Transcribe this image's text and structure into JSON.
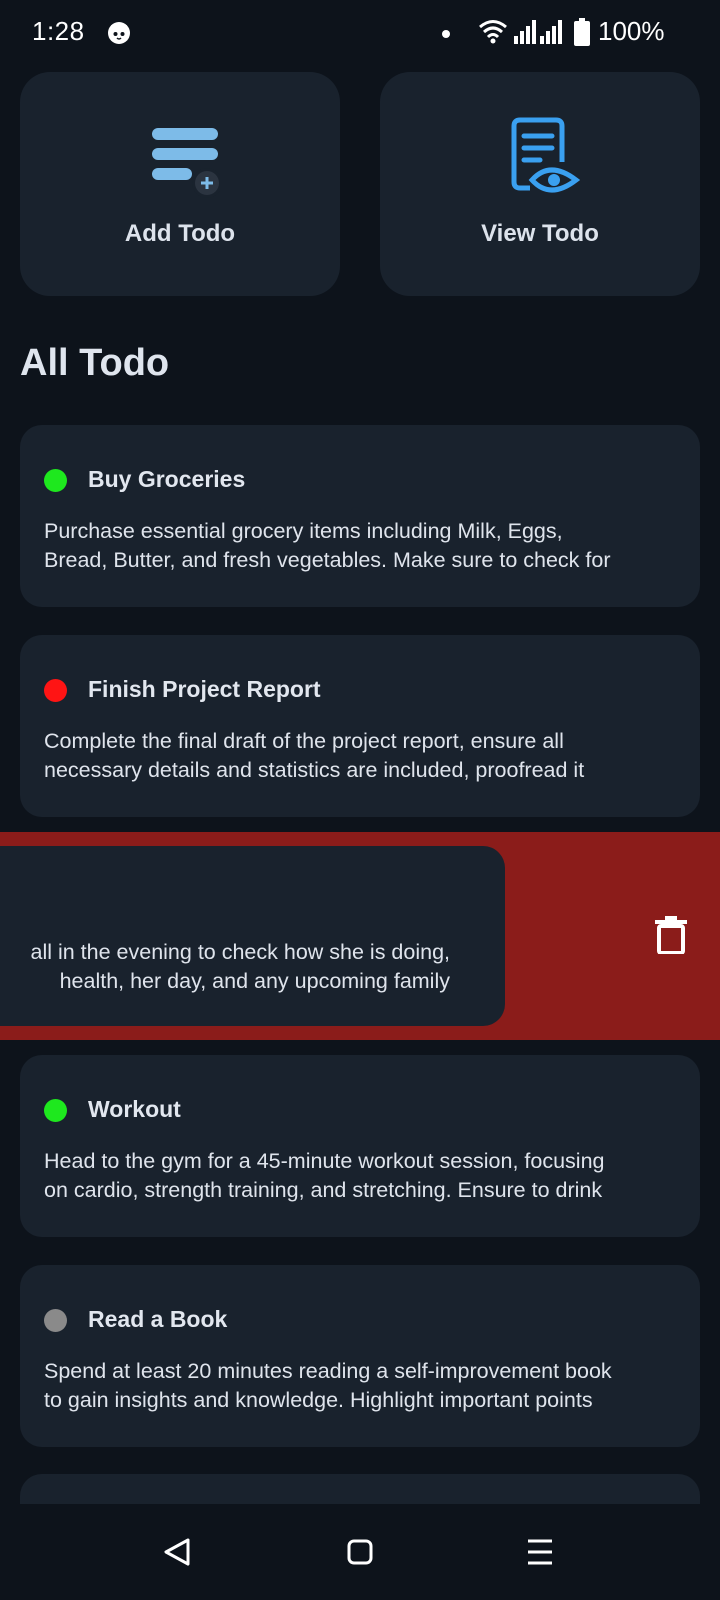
{
  "status_bar": {
    "time": "1:28",
    "battery": "100%"
  },
  "actions": {
    "add_label": "Add Todo",
    "view_label": "View Todo"
  },
  "section_title": "All Todo",
  "todos": [
    {
      "title": "Buy Groceries",
      "description": "Purchase essential grocery items including Milk, Eggs, Bread, Butter, and fresh vegetables. Make sure to check for",
      "line1": "Purchase essential grocery items including Milk, Eggs,",
      "line2": "Bread, Butter, and fresh vegetables. Make sure to check for",
      "status_color": "#1ee81e"
    },
    {
      "title": "Finish Project Report",
      "line1": "Complete the final draft of the project report, ensure all",
      "line2": "necessary details and statistics are included, proofread it",
      "status_color": "#ff1414"
    },
    {
      "line1": "all in the evening to check how she is doing,",
      "line2": "health, her day, and any upcoming family",
      "swiped": true
    },
    {
      "title": "Workout",
      "line1": "Head to the gym for a 45-minute workout session, focusing",
      "line2": "on cardio, strength training, and stretching. Ensure to drink",
      "status_color": "#1ee81e"
    },
    {
      "title": "Read a Book",
      "line1": "Spend at least 20 minutes reading a self-improvement book",
      "line2": "to gain insights and knowledge. Highlight important points",
      "status_color": "#8a8a8a"
    }
  ],
  "icons": {
    "add": "add-todo-icon",
    "view": "view-todo-icon",
    "delete": "trash-icon"
  },
  "colors": {
    "background": "#0d131b",
    "card": "#19222d",
    "swipe_delete": "#8b1c1a",
    "accent_blue": "#3aa0f0"
  }
}
